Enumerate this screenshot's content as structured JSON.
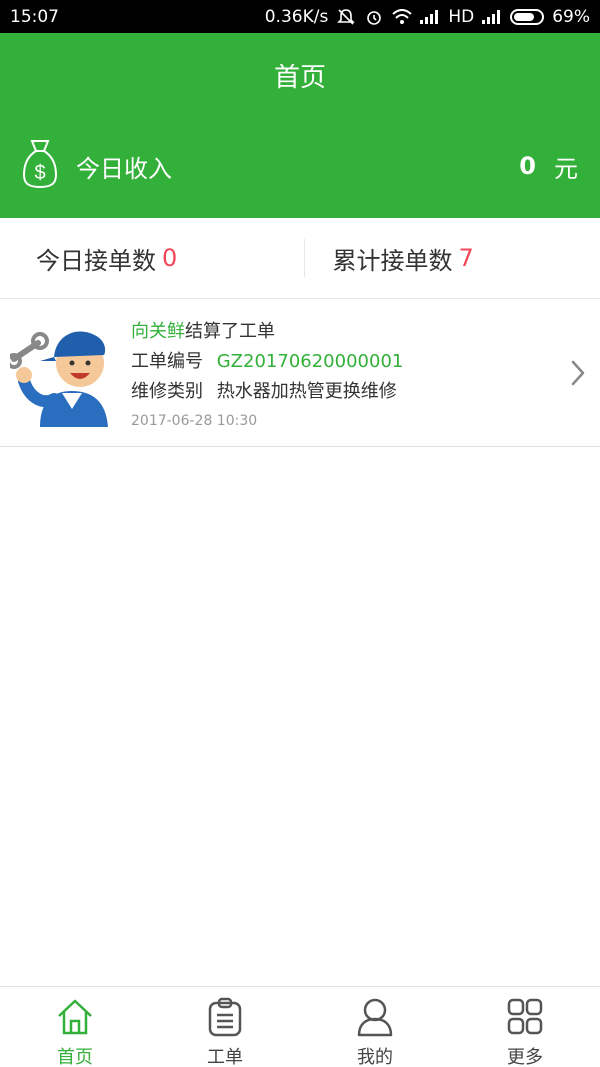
{
  "status_bar": {
    "time": "15:07",
    "network_speed": "0.36K/s",
    "signal_label": "HD",
    "battery": "69%"
  },
  "header": {
    "title": "首页",
    "income_label": "今日收入",
    "income_amount": "0",
    "income_unit": "元"
  },
  "stats": {
    "today_label": "今日接单数",
    "today_value": "0",
    "total_label": "累计接单数",
    "total_value": "7"
  },
  "order": {
    "user_name": "向关鲜",
    "action_text": "结算了工单",
    "order_no_label": "工单编号",
    "order_no": "GZ20170620000001",
    "repair_type_label": "维修类别",
    "repair_type": "热水器加热管更换维修",
    "timestamp": "2017-06-28 10:30"
  },
  "tabs": [
    {
      "label": "首页",
      "icon": "home-icon",
      "active": true
    },
    {
      "label": "工单",
      "icon": "clipboard-icon",
      "active": false
    },
    {
      "label": "我的",
      "icon": "user-icon",
      "active": false
    },
    {
      "label": "更多",
      "icon": "grid-icon",
      "active": false
    }
  ],
  "colors": {
    "brand_green": "#33b039",
    "count_red": "#f0485a"
  }
}
